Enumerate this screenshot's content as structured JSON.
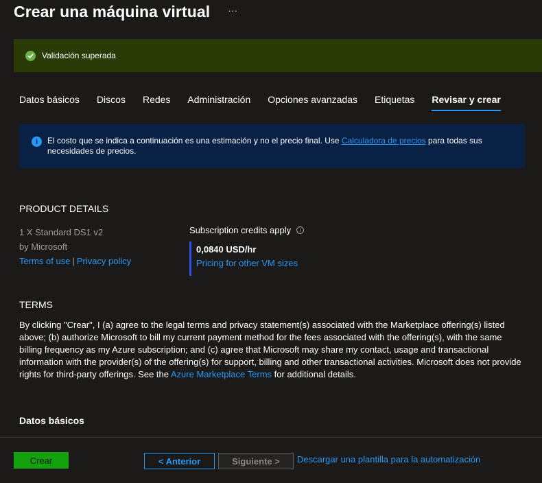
{
  "header": {
    "title": "Crear una máquina virtual",
    "more_label": "···"
  },
  "validation": {
    "text": "Validación superada",
    "icon": "check-circle-icon",
    "color": "#6ab04c"
  },
  "tabs": [
    {
      "label": "Datos básicos"
    },
    {
      "label": "Discos"
    },
    {
      "label": "Redes"
    },
    {
      "label": "Administración"
    },
    {
      "label": "Opciones avanzadas"
    },
    {
      "label": "Etiquetas"
    },
    {
      "label": "Revisar y crear",
      "active": true
    }
  ],
  "info": {
    "text_before": "El costo que se indica a continuación es una estimación y no el precio final. Use",
    "link": "Calculadora de precios",
    "text_after": "para todas sus necesidades de precios."
  },
  "product": {
    "heading": "PRODUCT DETAILS",
    "name": "1 X Standard DS1 v2",
    "publisher": "by Microsoft",
    "terms_link": "Terms of use",
    "separator": "|",
    "privacy_link": "Privacy policy",
    "credits": "Subscription credits apply",
    "price": "0,0840 USD/hr",
    "pricing_link": "Pricing for other VM sizes"
  },
  "terms": {
    "heading": "TERMS",
    "body_before": "By clicking \"Crear\", I (a) agree to the legal terms and privacy statement(s) associated with the Marketplace offering(s) listed above; (b) authorize Microsoft to bill my current payment method for the fees associated with the offering(s), with the same billing frequency as my Azure subscription; and (c) agree that Microsoft may share my contact, usage and transactional information with the provider(s) of the offering(s) for support, billing and other transactional activities. Microsoft does not provide rights for third-party offerings. See the",
    "link": "Azure Marketplace Terms",
    "body_after": "for additional details."
  },
  "summary": {
    "heading": "Datos básicos"
  },
  "footer": {
    "create": "Crear",
    "previous": "< Anterior",
    "next": "Siguiente >",
    "download": "Descargar una plantilla para la automatización"
  },
  "colors": {
    "accent": "#2899f5",
    "success_bg": "#2a3b07",
    "info_bg": "#0a2146",
    "create_button": "#13a10e"
  }
}
